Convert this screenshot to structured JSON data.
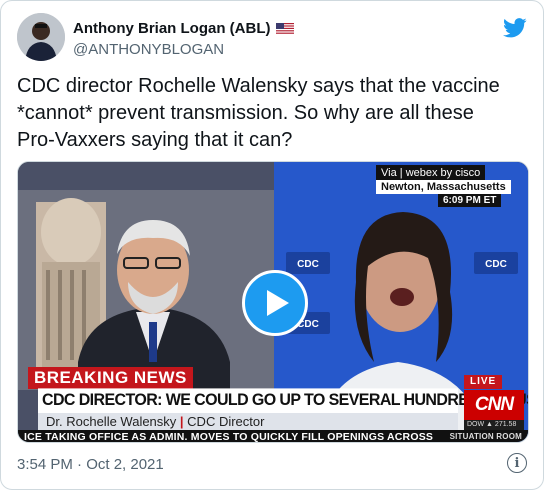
{
  "author": {
    "display_name": "Anthony Brian Logan (ABL)",
    "handle": "@ANTHONYBLOGAN",
    "flag_icon": "us-flag-icon"
  },
  "tweet": {
    "text": "CDC director Rochelle Walensky says that the vaccine\n*cannot* prevent transmission. So why are all these\nPro-Vaxxers saying that it can?",
    "timestamp": "3:54 PM · Oct 2, 2021"
  },
  "video": {
    "via": "Via",
    "webex_brand": "webex by cisco",
    "location": "Newton, Massachusetts",
    "time": "6:09 PM ET",
    "breaking_label": "BREAKING NEWS",
    "headline": "CDC DIRECTOR: WE COULD GO UP TO SEVERAL HUNDRED THOUSAND CASES A DAY",
    "name": "Dr. Rochelle Walensky",
    "title": "CDC Director",
    "ticker": "ICE TAKING OFFICE AS ADMIN. MOVES TO QUICKLY FILL OPENINGS ACROSS",
    "ticker_right": "SITUATION ROOM",
    "live_label": "LIVE",
    "network": "CNN",
    "dow": "DOW ▲ 271.58",
    "cdc_logo_text": "CDC"
  },
  "colors": {
    "twitter_blue": "#1d9bf0",
    "cnn_red": "#c4161c"
  }
}
